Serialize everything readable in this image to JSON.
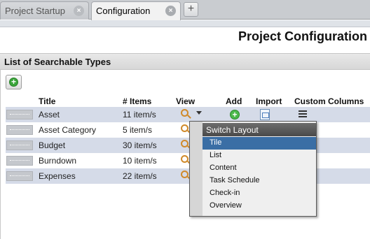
{
  "tabs": [
    {
      "label": "Project Startup",
      "close": "×"
    },
    {
      "label": "Configuration",
      "close": "×"
    }
  ],
  "tab_add": "+",
  "page_title": "Project Configuration",
  "section_title": "List of Searchable Types",
  "add_button_glyph": "+",
  "table": {
    "headers": {
      "title": "Title",
      "items": "# Items",
      "view": "View",
      "add": "Add",
      "import": "Import",
      "custom": "Custom Columns"
    },
    "rows": [
      {
        "title": "Asset",
        "items": "11 item/s"
      },
      {
        "title": "Asset Category",
        "items": "5 item/s"
      },
      {
        "title": "Budget",
        "items": "30 item/s"
      },
      {
        "title": "Burndown",
        "items": "10 item/s"
      },
      {
        "title": "Expenses",
        "items": "22 item/s"
      }
    ]
  },
  "menu": {
    "header": "Switch Layout",
    "items": [
      "Tile",
      "List",
      "Content",
      "Task Schedule",
      "Check-in",
      "Overview"
    ],
    "selected": "Tile"
  },
  "icons": {
    "view": "magnifier-icon",
    "add": "add-circle-icon",
    "import": "import-icon",
    "custom": "columns-icon"
  },
  "colors": {
    "row_stripe": "#d5dbe8",
    "menu_selected": "#3a6ea5",
    "add_green": "#3aa53a",
    "magnifier": "#d08a2a"
  }
}
